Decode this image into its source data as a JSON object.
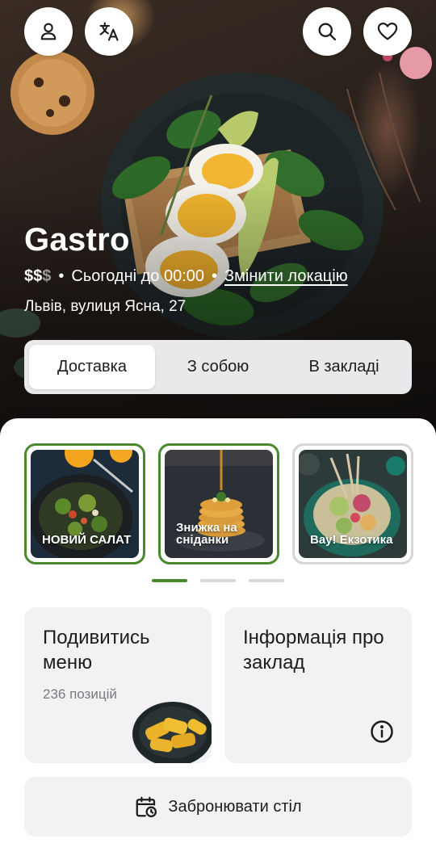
{
  "header": {
    "buttons": [
      {
        "icon": "user-icon"
      },
      {
        "icon": "translate-icon"
      },
      {
        "icon": "search-icon"
      },
      {
        "icon": "heart-icon"
      }
    ]
  },
  "venue": {
    "name": "Gastro",
    "price_active": "$$",
    "price_inactive": "$",
    "hours": "Сьогодні до 00:00",
    "change_location": "Змінити локацію",
    "address": "Львів, вулиця Ясна, 27"
  },
  "tabs": [
    {
      "label": "Доставка",
      "active": true
    },
    {
      "label": "З собою",
      "active": false
    },
    {
      "label": "В закладі",
      "active": false
    }
  ],
  "stories": [
    {
      "label": "НОВИЙ САЛАТ",
      "seen": false
    },
    {
      "label": "Знижка на сніданки",
      "seen": false
    },
    {
      "label": "Вау! Екзотика",
      "seen": true
    }
  ],
  "pager": {
    "count": 3,
    "active_index": 0
  },
  "cards": {
    "menu": {
      "title": "Подивитись меню",
      "subtitle": "236 позицій"
    },
    "info": {
      "title": "Інформація про заклад",
      "icon": "info-icon"
    }
  },
  "booking": {
    "label": "Забронювати стіл",
    "icon": "calendar-clock-icon"
  },
  "colors": {
    "accent": "#4a8a2e",
    "surface": "#f2f2f4",
    "text": "#1c1c1e"
  }
}
